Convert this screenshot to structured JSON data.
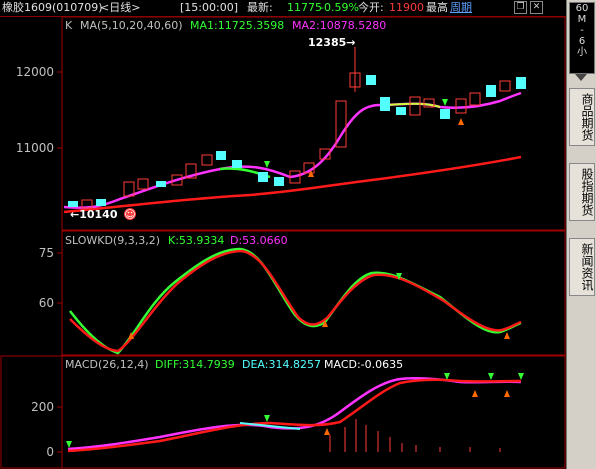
{
  "header": {
    "instrument": "橡胶1609",
    "code": "(010709)",
    "period": "<日线>",
    "time": "[15:00:00]",
    "latest_label": "最新:",
    "latest_value": "11775",
    "change_pct": "-0.59%",
    "open_label": "今开:",
    "open_value": "11900",
    "high_label": "最高",
    "weekly_link": "周期"
  },
  "window_buttons": {
    "restore": "❐",
    "close": "✕"
  },
  "sidebar": {
    "top_labels": [
      "60",
      "M",
      "-",
      "6",
      "小"
    ],
    "tabs": [
      "商品期货",
      "股指期货",
      "新闻资讯"
    ]
  },
  "colors": {
    "up": "#ff3b3b",
    "down": "#54ffff",
    "ma1": "#ffff00",
    "ma_pink": "#ff33ff",
    "ma_green": "#33ff33",
    "ma_red": "#ff1a1a",
    "grid_border": "#a00000",
    "axis_text": "#c0c0c0"
  },
  "main_panel": {
    "indicator_label": "K",
    "ma_spec": "MA(5,10,20,40,60)",
    "ma1_label": "MA1:11725.3598",
    "ma2_label": "MA2:10878.5280",
    "high_annotation": "12385→",
    "low_annotation": "←10140",
    "smiley_icon": "☺",
    "y_ticks": [
      "12000",
      "11000"
    ]
  },
  "kd_panel": {
    "name": "SLOWKD(9,3,3,2)",
    "k_label": "K:53.9334",
    "d_label": "D:53.0660",
    "y_ticks": [
      "75",
      "60"
    ]
  },
  "macd_panel": {
    "name": "MACD(26,12,4)",
    "diff_label": "DIFF:314.7939",
    "dea_label": "DEA:314.8257",
    "macd_label": "MACD:-0.0635",
    "y_ticks": [
      "200",
      "0"
    ]
  }
}
